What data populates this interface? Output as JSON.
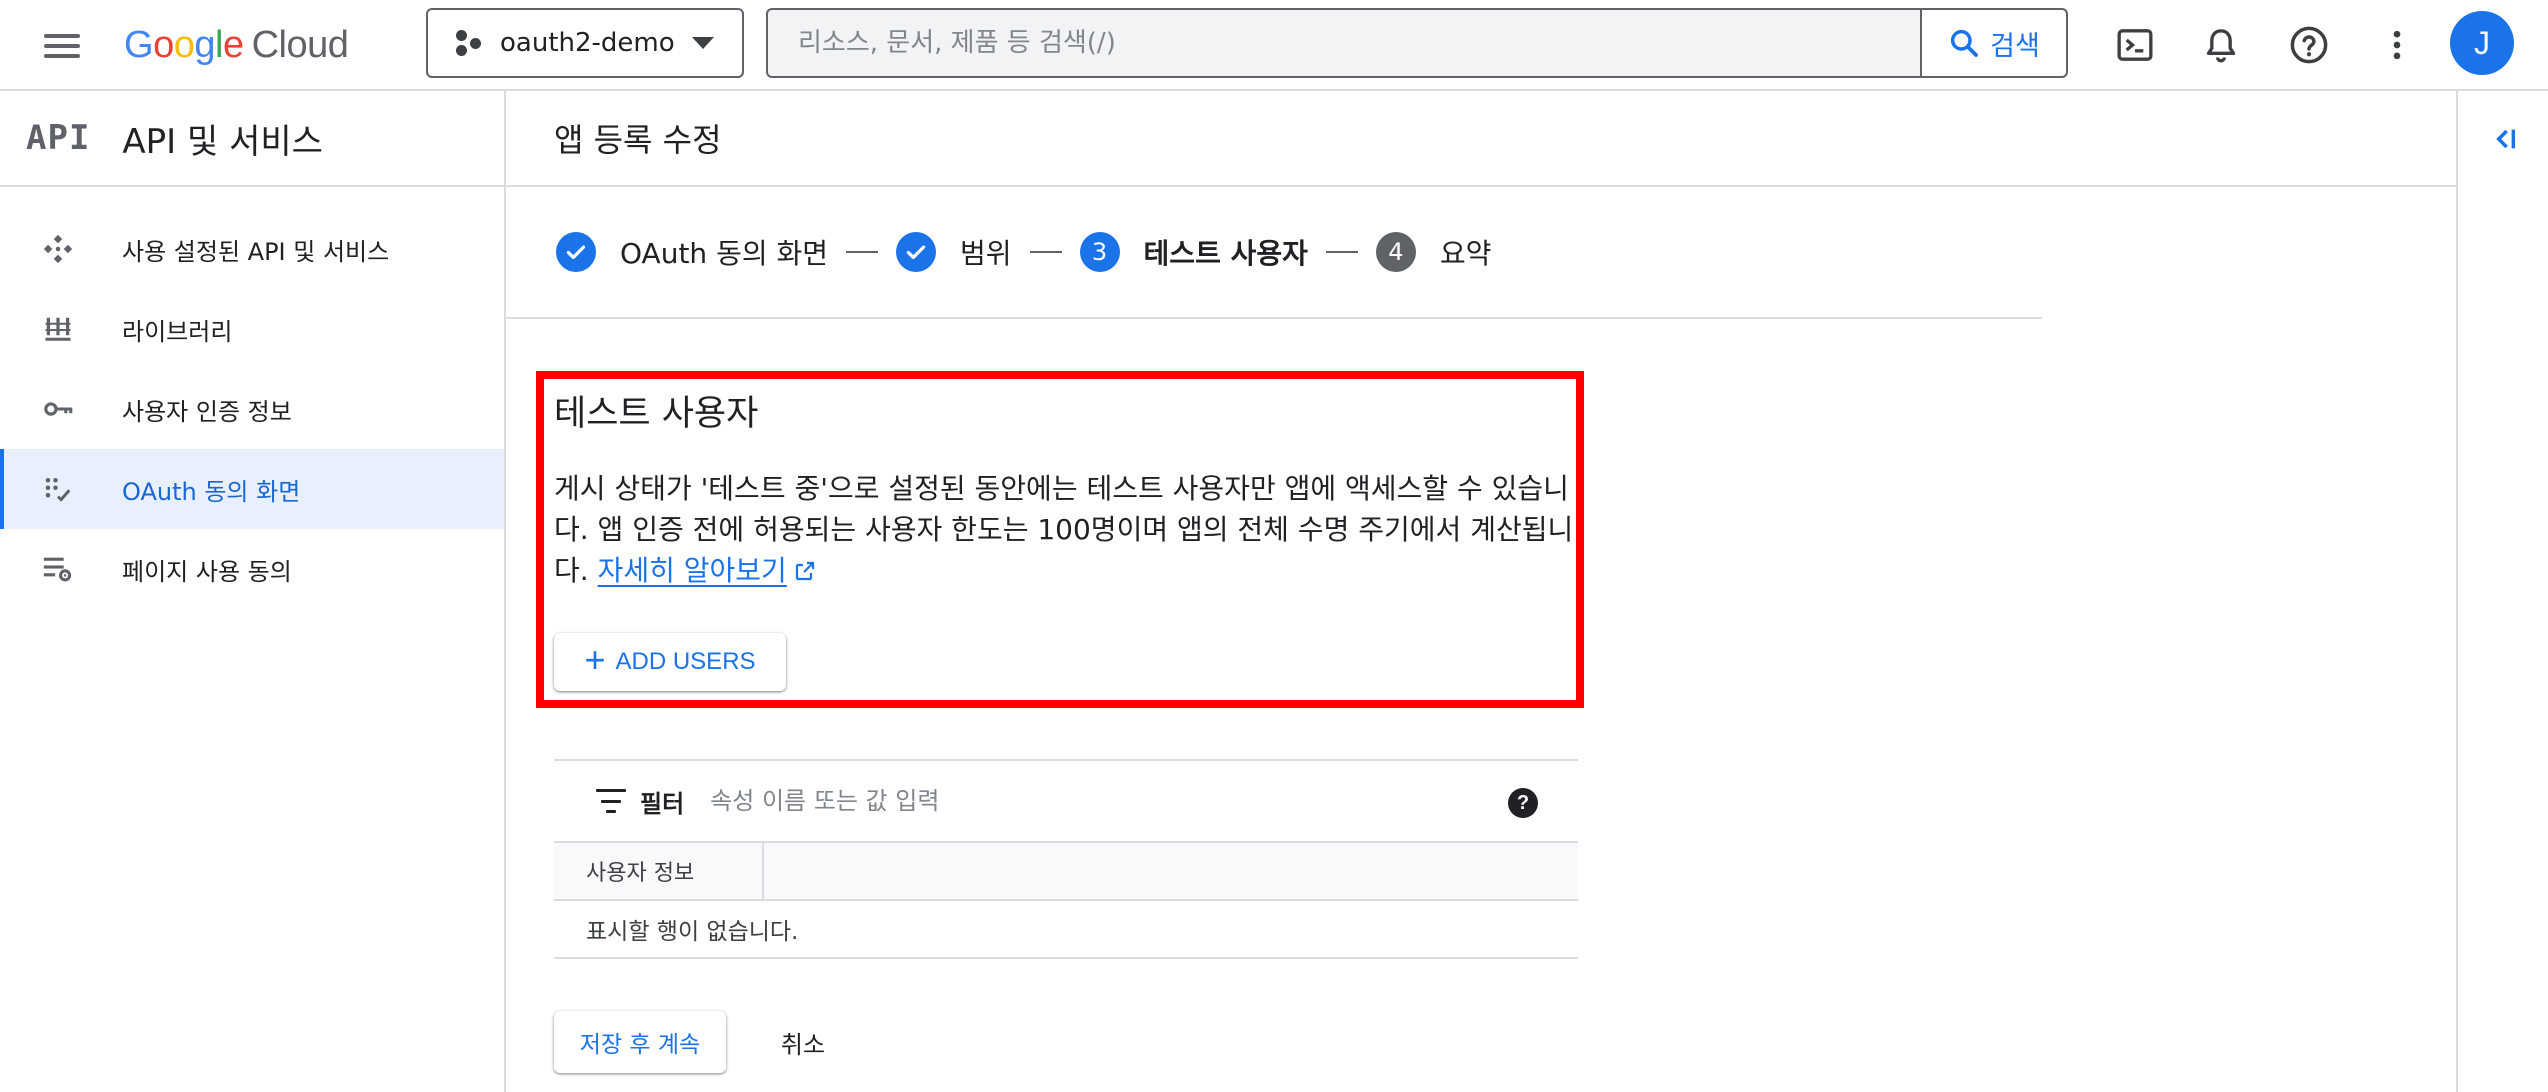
{
  "topbar": {
    "logo": {
      "g1": "G",
      "g2": "o",
      "g3": "o",
      "g4": "g",
      "g5": "l",
      "g6": "e",
      "cloud": "Cloud"
    },
    "project": {
      "name": "oauth2-demo"
    },
    "search": {
      "placeholder": "리소스, 문서, 제품 등 검색(/)",
      "button_label": "검색"
    },
    "icons": [
      "terminal-icon",
      "bell-icon",
      "help-icon",
      "more-vert-icon"
    ],
    "avatar_initial": "J"
  },
  "leftnav": {
    "badge": "API",
    "title": "API 및 서비스",
    "items": [
      {
        "label": "사용 설정된 API 및 서비스",
        "icon": "api-diamond-icon",
        "active": false
      },
      {
        "label": "라이브러리",
        "icon": "library-icon",
        "active": false
      },
      {
        "label": "사용자 인증 정보",
        "icon": "key-icon",
        "active": false
      },
      {
        "label": "OAuth 동의 화면",
        "icon": "consent-grid-icon",
        "active": true
      },
      {
        "label": "페이지 사용 동의",
        "icon": "settings-list-icon",
        "active": false
      }
    ]
  },
  "main": {
    "page_title": "앱 등록 수정",
    "steps": [
      {
        "label": "OAuth 동의 화면",
        "state": "done"
      },
      {
        "label": "범위",
        "state": "done"
      },
      {
        "number": "3",
        "label": "테스트 사용자",
        "state": "current"
      },
      {
        "number": "4",
        "label": "요약",
        "state": "future"
      }
    ],
    "section": {
      "title": "테스트 사용자",
      "description": "게시 상태가 '테스트 중'으로 설정된 동안에는 테스트 사용자만 앱에 액세스할 수 있습니다. 앱 인증 전에 허용되는 사용자 한도는 100명이며 앱의 전체 수명 주기에서 계산됩니다. ",
      "link_text": "자세히 알아보기"
    },
    "add_users_label": "ADD USERS",
    "table": {
      "filter_label": "필터",
      "filter_placeholder": "속성 이름 또는 값 입력",
      "help_symbol": "?",
      "column_header": "사용자 정보",
      "empty_message": "표시할 행이 없습니다."
    },
    "buttons": {
      "save": "저장 후 계속",
      "cancel": "취소"
    }
  },
  "colors": {
    "accent": "#1a73e8",
    "highlight_border": "#ff0000",
    "nav_active_bg": "#e8f0fe",
    "step_future": "#5f6368"
  }
}
